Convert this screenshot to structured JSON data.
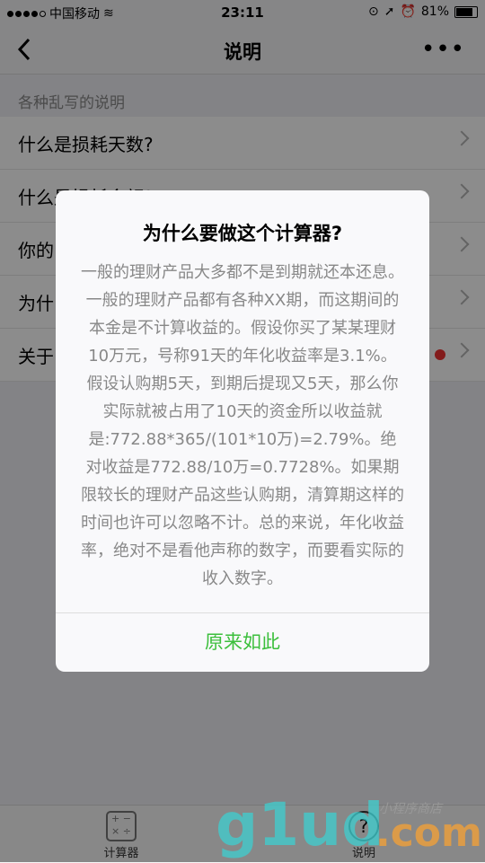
{
  "status_bar": {
    "carrier": "中国移动",
    "time": "23:11",
    "battery": "81%"
  },
  "navbar": {
    "title": "说明",
    "back_icon": "chevron-left-icon",
    "more_icon": "more-horizontal-icon"
  },
  "section_header": "各种乱写的说明",
  "list": {
    "items": [
      {
        "label": "什么是损耗天数?"
      },
      {
        "label": "什么是损耗金额?"
      },
      {
        "label": "你的"
      },
      {
        "label": "为什"
      },
      {
        "label": "关于",
        "has_badge": true
      }
    ]
  },
  "modal": {
    "title": "为什么要做这个计算器?",
    "body": "一般的理财产品大多都不是到期就还本还息。一般的理财产品都有各种XX期，而这期间的本金是不计算收益的。假设你买了某某理财10万元，号称91天的年化收益率是3.1%。假设认购期5天，到期后提现又5天，那么你实际就被占用了10天的资金所以收益就是:772.88*365/(101*10万)=2.79%。绝对收益是772.88/10万=0.7728%。如果期限较长的理财产品这些认购期，清算期这样的时间也许可以忽略不计。总的来说，年化收益率，绝对不是看他声称的数字，而要看实际的收入数字。",
    "confirm": "原来如此"
  },
  "tabbar": {
    "tabs": [
      {
        "label": "计算器",
        "icon": "calculator-icon"
      },
      {
        "label": "说明",
        "icon": "help-icon"
      }
    ]
  },
  "watermark": {
    "brand": "g1ud",
    "suffix": ".com",
    "note": "小程序商店"
  },
  "colors": {
    "accent": "#3cbf3c",
    "badge": "#e33333"
  }
}
